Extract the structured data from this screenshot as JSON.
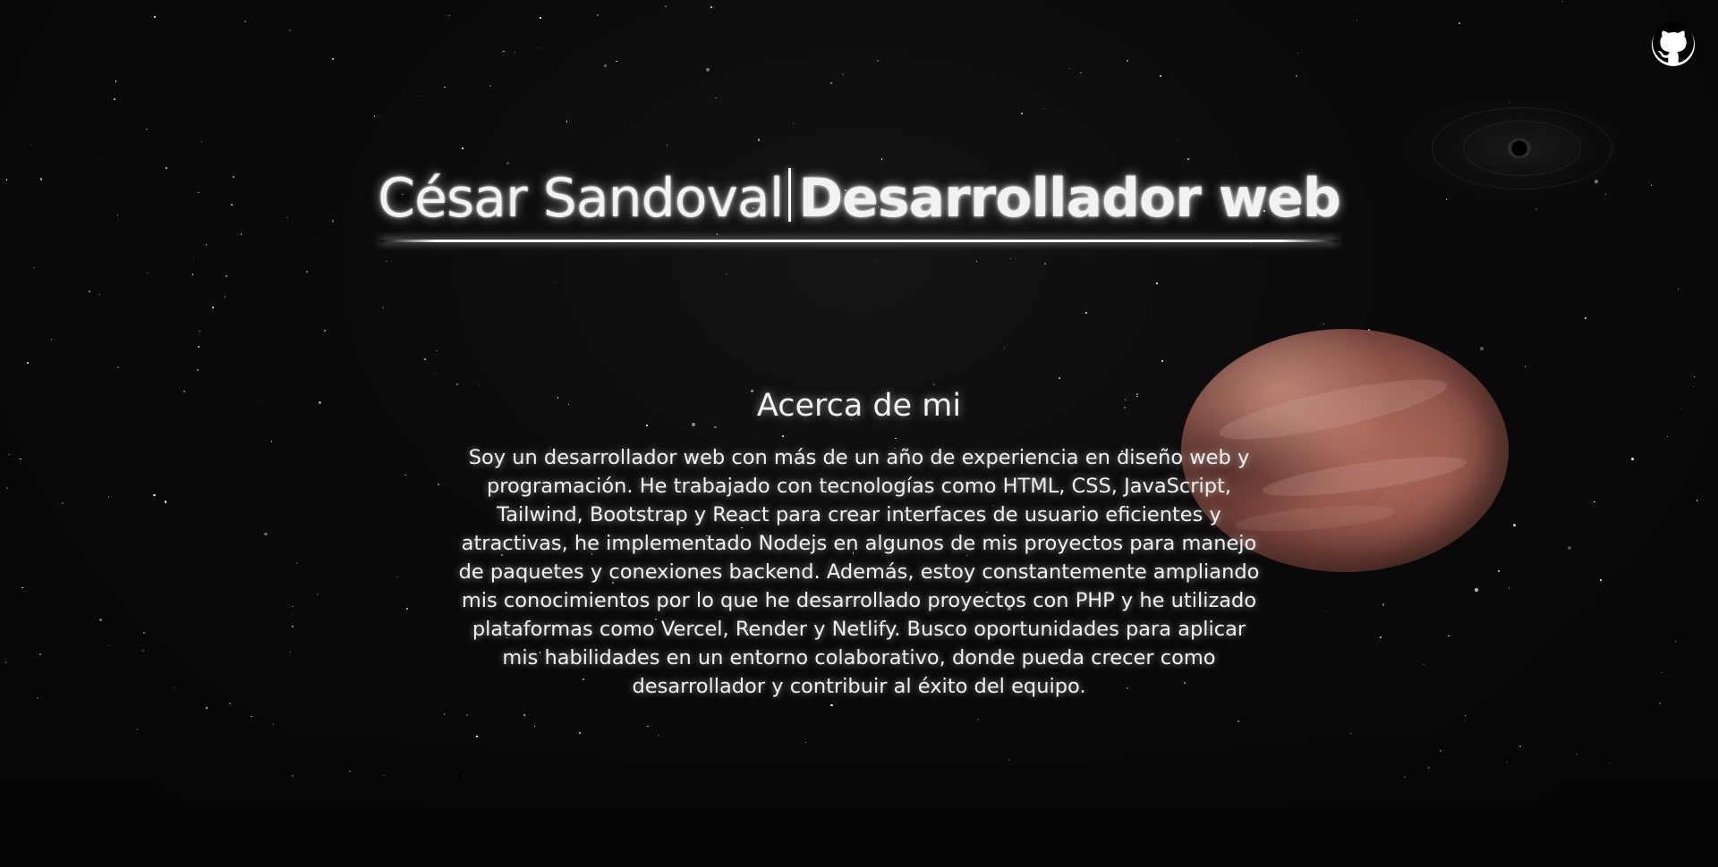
{
  "links": {
    "github_icon": "github-icon"
  },
  "header": {
    "name": "César Sandoval",
    "role": "Desarrollador web"
  },
  "about": {
    "title": "Acerca de mi",
    "text": "Soy un desarrollador web con más de un año de experiencia en diseño web y programación. He trabajado con tecnologías como HTML, CSS, JavaScript, Tailwind, Bootstrap y React para crear interfaces de usuario eficientes y atractivas, he implementado Nodejs en algunos de mis proyectos para manejo de paquetes y conexiones backend. Además, estoy constantemente ampliando mis conocimientos por lo que he desarrollado proyectos con PHP y he utilizado plataformas como Vercel, Render y Netlify. Busco oportunidades para aplicar mis habilidades en un entorno colaborativo, donde pueda crecer como desarrollador y contribuir al éxito del equipo."
  },
  "colors": {
    "background": "#050505",
    "text": "#f2f2f2",
    "planet": "#8a4f45"
  }
}
